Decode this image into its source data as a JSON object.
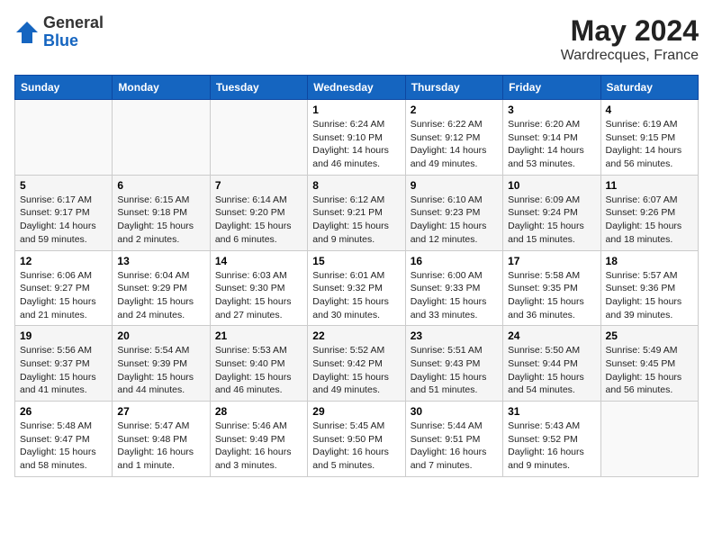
{
  "header": {
    "logo_general": "General",
    "logo_blue": "Blue",
    "month": "May 2024",
    "location": "Wardrecques, France"
  },
  "days_of_week": [
    "Sunday",
    "Monday",
    "Tuesday",
    "Wednesday",
    "Thursday",
    "Friday",
    "Saturday"
  ],
  "weeks": [
    [
      {
        "day": "",
        "info": ""
      },
      {
        "day": "",
        "info": ""
      },
      {
        "day": "",
        "info": ""
      },
      {
        "day": "1",
        "info": "Sunrise: 6:24 AM\nSunset: 9:10 PM\nDaylight: 14 hours\nand 46 minutes."
      },
      {
        "day": "2",
        "info": "Sunrise: 6:22 AM\nSunset: 9:12 PM\nDaylight: 14 hours\nand 49 minutes."
      },
      {
        "day": "3",
        "info": "Sunrise: 6:20 AM\nSunset: 9:14 PM\nDaylight: 14 hours\nand 53 minutes."
      },
      {
        "day": "4",
        "info": "Sunrise: 6:19 AM\nSunset: 9:15 PM\nDaylight: 14 hours\nand 56 minutes."
      }
    ],
    [
      {
        "day": "5",
        "info": "Sunrise: 6:17 AM\nSunset: 9:17 PM\nDaylight: 14 hours\nand 59 minutes."
      },
      {
        "day": "6",
        "info": "Sunrise: 6:15 AM\nSunset: 9:18 PM\nDaylight: 15 hours\nand 2 minutes."
      },
      {
        "day": "7",
        "info": "Sunrise: 6:14 AM\nSunset: 9:20 PM\nDaylight: 15 hours\nand 6 minutes."
      },
      {
        "day": "8",
        "info": "Sunrise: 6:12 AM\nSunset: 9:21 PM\nDaylight: 15 hours\nand 9 minutes."
      },
      {
        "day": "9",
        "info": "Sunrise: 6:10 AM\nSunset: 9:23 PM\nDaylight: 15 hours\nand 12 minutes."
      },
      {
        "day": "10",
        "info": "Sunrise: 6:09 AM\nSunset: 9:24 PM\nDaylight: 15 hours\nand 15 minutes."
      },
      {
        "day": "11",
        "info": "Sunrise: 6:07 AM\nSunset: 9:26 PM\nDaylight: 15 hours\nand 18 minutes."
      }
    ],
    [
      {
        "day": "12",
        "info": "Sunrise: 6:06 AM\nSunset: 9:27 PM\nDaylight: 15 hours\nand 21 minutes."
      },
      {
        "day": "13",
        "info": "Sunrise: 6:04 AM\nSunset: 9:29 PM\nDaylight: 15 hours\nand 24 minutes."
      },
      {
        "day": "14",
        "info": "Sunrise: 6:03 AM\nSunset: 9:30 PM\nDaylight: 15 hours\nand 27 minutes."
      },
      {
        "day": "15",
        "info": "Sunrise: 6:01 AM\nSunset: 9:32 PM\nDaylight: 15 hours\nand 30 minutes."
      },
      {
        "day": "16",
        "info": "Sunrise: 6:00 AM\nSunset: 9:33 PM\nDaylight: 15 hours\nand 33 minutes."
      },
      {
        "day": "17",
        "info": "Sunrise: 5:58 AM\nSunset: 9:35 PM\nDaylight: 15 hours\nand 36 minutes."
      },
      {
        "day": "18",
        "info": "Sunrise: 5:57 AM\nSunset: 9:36 PM\nDaylight: 15 hours\nand 39 minutes."
      }
    ],
    [
      {
        "day": "19",
        "info": "Sunrise: 5:56 AM\nSunset: 9:37 PM\nDaylight: 15 hours\nand 41 minutes."
      },
      {
        "day": "20",
        "info": "Sunrise: 5:54 AM\nSunset: 9:39 PM\nDaylight: 15 hours\nand 44 minutes."
      },
      {
        "day": "21",
        "info": "Sunrise: 5:53 AM\nSunset: 9:40 PM\nDaylight: 15 hours\nand 46 minutes."
      },
      {
        "day": "22",
        "info": "Sunrise: 5:52 AM\nSunset: 9:42 PM\nDaylight: 15 hours\nand 49 minutes."
      },
      {
        "day": "23",
        "info": "Sunrise: 5:51 AM\nSunset: 9:43 PM\nDaylight: 15 hours\nand 51 minutes."
      },
      {
        "day": "24",
        "info": "Sunrise: 5:50 AM\nSunset: 9:44 PM\nDaylight: 15 hours\nand 54 minutes."
      },
      {
        "day": "25",
        "info": "Sunrise: 5:49 AM\nSunset: 9:45 PM\nDaylight: 15 hours\nand 56 minutes."
      }
    ],
    [
      {
        "day": "26",
        "info": "Sunrise: 5:48 AM\nSunset: 9:47 PM\nDaylight: 15 hours\nand 58 minutes."
      },
      {
        "day": "27",
        "info": "Sunrise: 5:47 AM\nSunset: 9:48 PM\nDaylight: 16 hours\nand 1 minute."
      },
      {
        "day": "28",
        "info": "Sunrise: 5:46 AM\nSunset: 9:49 PM\nDaylight: 16 hours\nand 3 minutes."
      },
      {
        "day": "29",
        "info": "Sunrise: 5:45 AM\nSunset: 9:50 PM\nDaylight: 16 hours\nand 5 minutes."
      },
      {
        "day": "30",
        "info": "Sunrise: 5:44 AM\nSunset: 9:51 PM\nDaylight: 16 hours\nand 7 minutes."
      },
      {
        "day": "31",
        "info": "Sunrise: 5:43 AM\nSunset: 9:52 PM\nDaylight: 16 hours\nand 9 minutes."
      },
      {
        "day": "",
        "info": ""
      }
    ]
  ]
}
